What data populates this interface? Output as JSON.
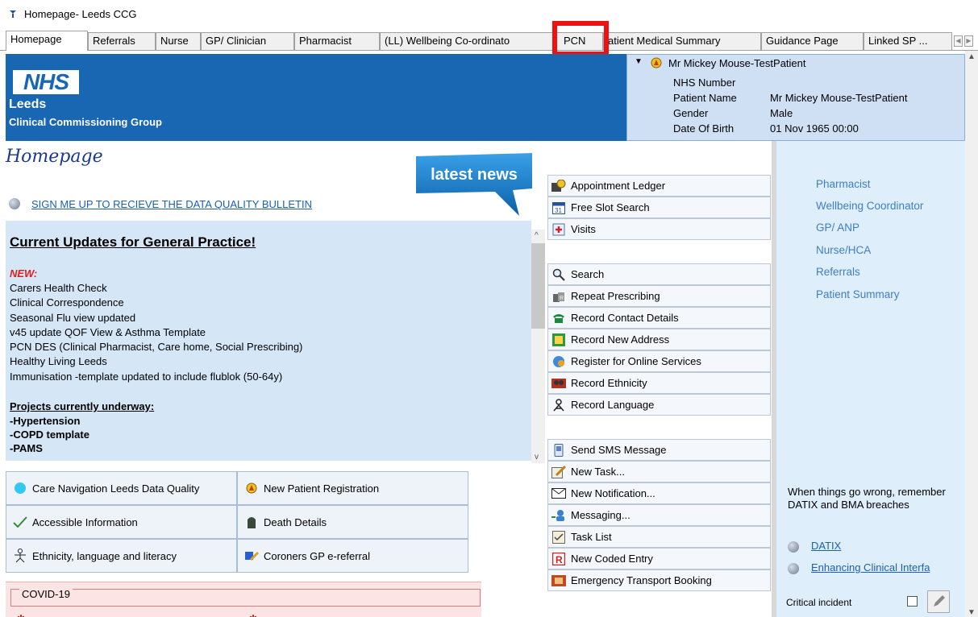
{
  "window": {
    "title": "Homepage- Leeds CCG",
    "icon": "app-icon"
  },
  "tabs": [
    {
      "label": "Homepage",
      "active": true
    },
    {
      "label": "Referrals"
    },
    {
      "label": "Nurse"
    },
    {
      "label": "GP/ Clinician"
    },
    {
      "label": "Pharmacist"
    },
    {
      "label": "(LL) Wellbeing Co-ordinato"
    },
    {
      "label": "PCN"
    },
    {
      "label": "atient Medical Summary"
    },
    {
      "label": "Guidance Page"
    },
    {
      "label": "Linked SP ..."
    }
  ],
  "banner": {
    "logo": "NHS",
    "org": "Leeds",
    "subtitle": "Clinical Commissioning Group",
    "color": "#1966b2"
  },
  "patient": {
    "header": "Mr Mickey Mouse-TestPatient",
    "fields": [
      {
        "label": "NHS Number",
        "value": ""
      },
      {
        "label": "Patient Name",
        "value": "Mr Mickey Mouse-TestPatient"
      },
      {
        "label": "Gender",
        "value": "Male"
      },
      {
        "label": "Date Of Birth",
        "value": "01 Nov 1965 00:00"
      }
    ]
  },
  "page_title": "Homepage",
  "latest_news": "latest news",
  "bulletin_link": "SIGN ME UP TO RECIEVE THE DATA QUALITY BULLETIN",
  "updates": {
    "heading": "Current Updates for General Practice!",
    "new_label": "NEW:",
    "items": [
      "Carers Health Check",
      "Clinical Correspondence",
      "Seasonal Flu view updated",
      "v45 update QOF View & Asthma Template",
      "PCN DES (Clinical Pharmacist, Care home, Social Prescribing)",
      "Healthy Living Leeds",
      "Immunisation -template updated to include flublok (50-64y)"
    ],
    "projects_label": "Projects currently underway:",
    "projects": [
      "-Hypertension",
      "-COPD template",
      "-PAMS"
    ]
  },
  "grid_buttons": [
    {
      "label": "Care Navigation Leeds Data Quality",
      "icon": "circle-icon"
    },
    {
      "label": "New Patient Registration",
      "icon": "registration-icon"
    },
    {
      "label": "Accessible Information",
      "icon": "checkmark-icon"
    },
    {
      "label": "Death Details",
      "icon": "headstone-icon"
    },
    {
      "label": "Ethnicity, language and literacy",
      "icon": "person-icon"
    },
    {
      "label": "Coroners GP e-referral",
      "icon": "ereferral-icon"
    }
  ],
  "covid_label": "COVID-19",
  "actions_group1": [
    {
      "label": "Appointment Ledger",
      "icon": "ledger-icon"
    },
    {
      "label": "Free Slot Search",
      "icon": "calendar-icon"
    },
    {
      "label": "Visits",
      "icon": "visits-icon"
    }
  ],
  "actions_group2": [
    {
      "label": "Search",
      "icon": "search-icon"
    },
    {
      "label": "Repeat Prescribing",
      "icon": "prescribing-icon"
    },
    {
      "label": "Record Contact Details",
      "icon": "phone-icon"
    },
    {
      "label": "Record New Address",
      "icon": "address-icon"
    },
    {
      "label": "Register for Online Services",
      "icon": "online-services-icon"
    },
    {
      "label": "Record Ethnicity",
      "icon": "ethnicity-icon"
    },
    {
      "label": "Record Language",
      "icon": "language-icon"
    }
  ],
  "actions_group3": [
    {
      "label": "Send SMS Message",
      "icon": "sms-icon"
    },
    {
      "label": "New Task...",
      "icon": "task-icon"
    },
    {
      "label": "New Notification...",
      "icon": "envelope-icon"
    },
    {
      "label": "Messaging...",
      "icon": "messaging-icon"
    },
    {
      "label": "Task List",
      "icon": "task-list-icon"
    },
    {
      "label": "New Coded Entry",
      "icon": "coded-entry-icon"
    },
    {
      "label": "Emergency Transport Booking",
      "icon": "transport-icon"
    }
  ],
  "right_links": [
    "Pharmacist",
    "Wellbeing Coordinator",
    "GP/ ANP",
    "Nurse/HCA",
    "Referrals",
    "Patient Summary"
  ],
  "wrong_text": "When things go wrong, remember DATIX and BMA breaches",
  "external_links": [
    "DATIX",
    "Enhancing Clinical Interfa"
  ],
  "critical_label": "Critical incident"
}
